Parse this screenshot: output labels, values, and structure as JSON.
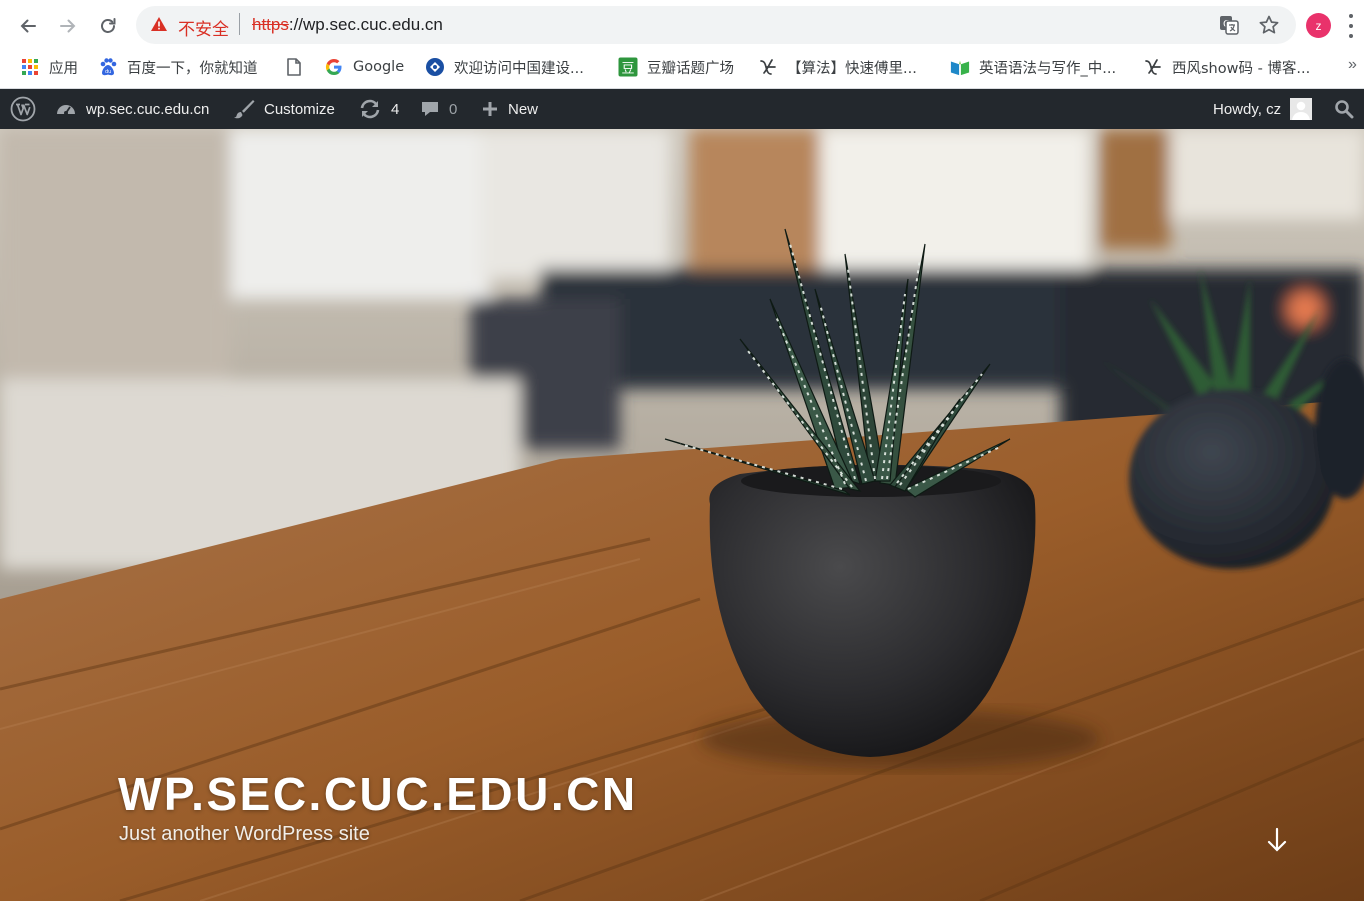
{
  "browser": {
    "insecure_label": "不安全",
    "url_scheme": "https",
    "url_rest": "://wp.sec.cuc.edu.cn",
    "profile_initial": "z"
  },
  "bookmarks": [
    {
      "label": "应用",
      "icon": "apps-grid-icon"
    },
    {
      "label": "百度一下，你就知道",
      "icon": "baidu-paw-icon"
    },
    {
      "label": "",
      "icon": "blank-page-icon"
    },
    {
      "label": "Google",
      "icon": "google-g-icon"
    },
    {
      "label": "欢迎访问中国建设...",
      "icon": "ccb-icon"
    },
    {
      "label": "豆瓣话题广场",
      "icon": "douban-icon"
    },
    {
      "label": "【算法】快速傅里...",
      "icon": "script-a-icon"
    },
    {
      "label": "英语语法与写作_中...",
      "icon": "book-icon"
    },
    {
      "label": "西风show码 - 博客...",
      "icon": "script-a-icon"
    }
  ],
  "adminbar": {
    "site_name": "wp.sec.cuc.edu.cn",
    "customize": "Customize",
    "updates_count": "4",
    "comments_count": "0",
    "new_label": "New",
    "howdy": "Howdy, cz"
  },
  "hero": {
    "site_title": "WP.SEC.CUC.EDU.CN",
    "tagline": "Just another WordPress site"
  },
  "colors": {
    "adminbar_bg": "#23282d",
    "insecure_red": "#d93025",
    "profile_pink": "#e9326b"
  }
}
